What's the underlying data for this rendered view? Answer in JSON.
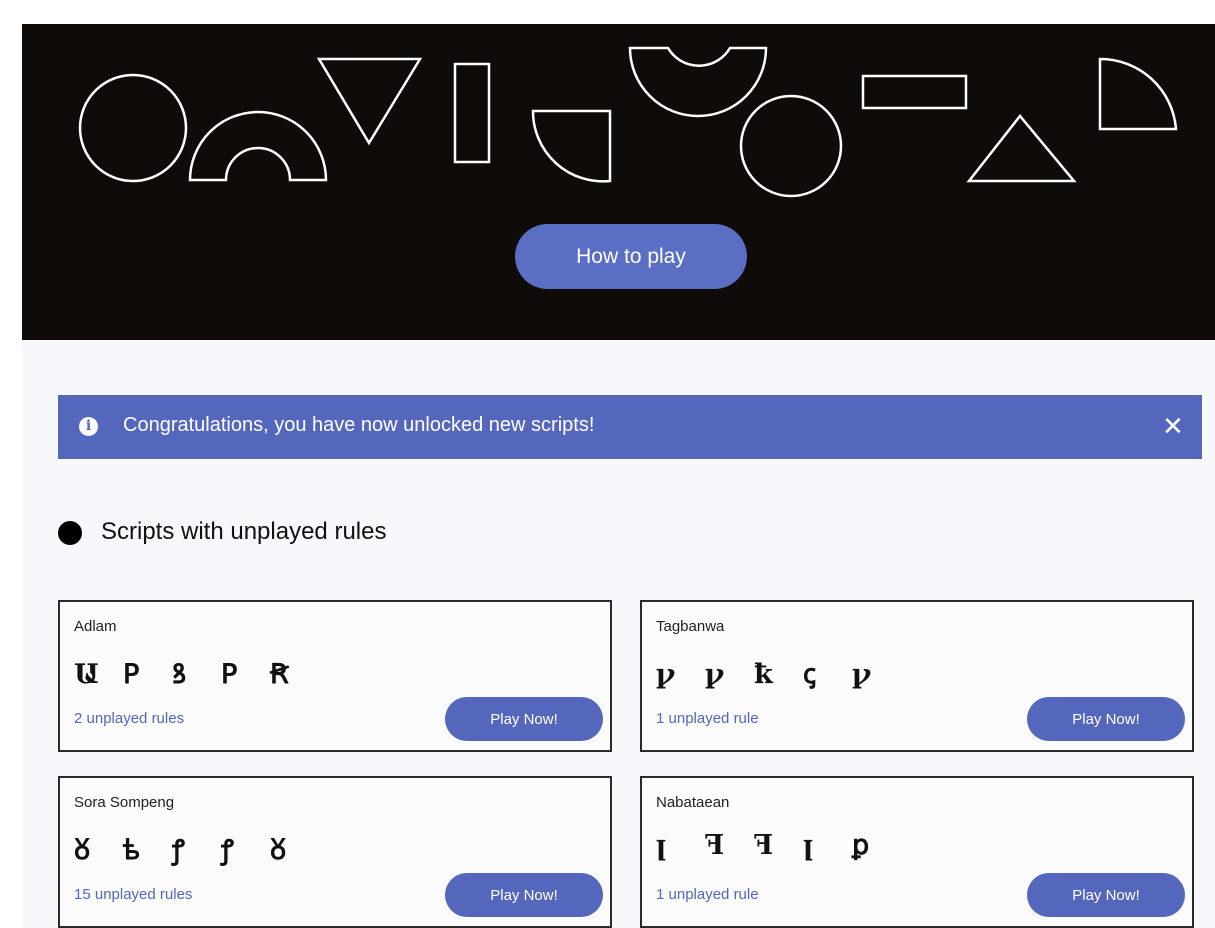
{
  "hero": {
    "how_to_play_label": "How to play"
  },
  "banner": {
    "icon": "info-icon",
    "icon_glyph": "i",
    "message": "Congratulations, you have now unlocked new scripts!",
    "close_glyph": "✕"
  },
  "section": {
    "title": "Scripts with unplayed rules"
  },
  "cards": [
    {
      "name": "Adlam",
      "glyphs": [
        "Ա",
        "ꓑ",
        "ꝸ",
        "ꓑ",
        "Ꞧ"
      ],
      "count": "2 unplayed rules",
      "button": "Play Now!"
    },
    {
      "name": "Tagbanwa",
      "glyphs": [
        "ꝩ",
        "ꝩ",
        "ꝁ",
        "ꞔ",
        "ꝩ"
      ],
      "count": "1 unplayed rule",
      "button": "Play Now!"
    },
    {
      "name": "Sora Sompeng",
      "glyphs": [
        "ᲈ",
        "ᲇ",
        "ꝭ",
        "ꝭ",
        "ᲈ"
      ],
      "count": "15 unplayed rules",
      "button": "Play Now!"
    },
    {
      "name": "Nabataean",
      "glyphs": [
        "ꞁ",
        "ꟻ",
        "ꟻ",
        "ꞁ",
        "ꝑ"
      ],
      "count": "1 unplayed rule",
      "button": "Play Now!"
    }
  ],
  "colors": {
    "accent": "#5566bd",
    "hero_bg": "#0e0b09",
    "page_bg": "#f7f8fb"
  }
}
